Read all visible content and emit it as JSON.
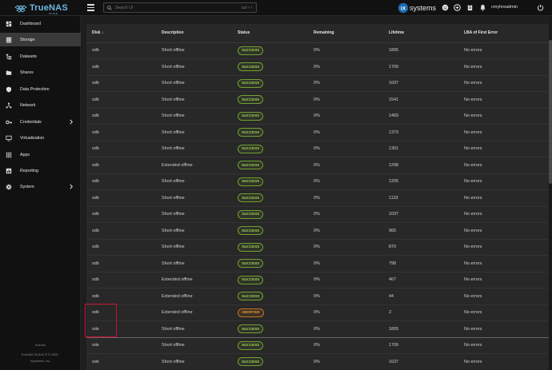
{
  "brand": {
    "name": "TrueNAS",
    "edition": "SCALE",
    "color": "#6fb7e0"
  },
  "search": {
    "placeholder": "Search UI",
    "shortcut": "Ctrl + /"
  },
  "partner": {
    "name": "systems",
    "prefix": "iX"
  },
  "user": {
    "name": "cmyhreadmin"
  },
  "topbar_icons": [
    "face-icon",
    "truecommand-icon",
    "jobs-icon",
    "notifications-icon",
    "user-icon",
    "power-icon"
  ],
  "sidebar": {
    "items": [
      {
        "label": "Dashboard",
        "icon": "dashboard-icon",
        "active": false
      },
      {
        "label": "Storage",
        "icon": "storage-icon",
        "active": true
      },
      {
        "label": "Datasets",
        "icon": "datasets-icon",
        "active": false
      },
      {
        "label": "Shares",
        "icon": "shares-icon",
        "active": false
      },
      {
        "label": "Data Protection",
        "icon": "shield-icon",
        "active": false
      },
      {
        "label": "Network",
        "icon": "network-icon",
        "active": false
      },
      {
        "label": "Credentials",
        "icon": "key-icon",
        "active": false,
        "expandable": true
      },
      {
        "label": "Virtualization",
        "icon": "monitor-icon",
        "active": false
      },
      {
        "label": "Apps",
        "icon": "apps-icon",
        "active": false
      },
      {
        "label": "Reporting",
        "icon": "chart-icon",
        "active": false
      },
      {
        "label": "System",
        "icon": "gear-icon",
        "active": false,
        "expandable": true
      }
    ],
    "footer": {
      "hostname": "truenas",
      "copyright": "TrueNAS SCALE ® © 2025 -",
      "company": "iXsystems, Inc."
    }
  },
  "table": {
    "columns": [
      "Disk",
      "Description",
      "Status",
      "Remaining",
      "Lifetime",
      "LBA of First Error"
    ],
    "sort_indicator": "↓",
    "rows": [
      {
        "disk": "sdb",
        "description": "Short offline",
        "status": "SUCCESS",
        "remaining": "0%",
        "lifetime": "1805",
        "lba": "No errors"
      },
      {
        "disk": "sdb",
        "description": "Short offline",
        "status": "SUCCESS",
        "remaining": "0%",
        "lifetime": "1709",
        "lba": "No errors"
      },
      {
        "disk": "sdb",
        "description": "Short offline",
        "status": "SUCCESS",
        "remaining": "0%",
        "lifetime": "1637",
        "lba": "No errors"
      },
      {
        "disk": "sdb",
        "description": "Short offline",
        "status": "SUCCESS",
        "remaining": "0%",
        "lifetime": "1541",
        "lba": "No errors"
      },
      {
        "disk": "sdb",
        "description": "Short offline",
        "status": "SUCCESS",
        "remaining": "0%",
        "lifetime": "1469",
        "lba": "No errors"
      },
      {
        "disk": "sdb",
        "description": "Short offline",
        "status": "SUCCESS",
        "remaining": "0%",
        "lifetime": "1373",
        "lba": "No errors"
      },
      {
        "disk": "sdb",
        "description": "Short offline",
        "status": "SUCCESS",
        "remaining": "0%",
        "lifetime": "1301",
        "lba": "No errors"
      },
      {
        "disk": "sdb",
        "description": "Extended offline",
        "status": "SUCCESS",
        "remaining": "0%",
        "lifetime": "1298",
        "lba": "No errors"
      },
      {
        "disk": "sdb",
        "description": "Short offline",
        "status": "SUCCESS",
        "remaining": "0%",
        "lifetime": "1205",
        "lba": "No errors"
      },
      {
        "disk": "sdb",
        "description": "Short offline",
        "status": "SUCCESS",
        "remaining": "0%",
        "lifetime": "1133",
        "lba": "No errors"
      },
      {
        "disk": "sdb",
        "description": "Short offline",
        "status": "SUCCESS",
        "remaining": "0%",
        "lifetime": "1037",
        "lba": "No errors"
      },
      {
        "disk": "sdb",
        "description": "Short offline",
        "status": "SUCCESS",
        "remaining": "0%",
        "lifetime": "965",
        "lba": "No errors"
      },
      {
        "disk": "sdb",
        "description": "Short offline",
        "status": "SUCCESS",
        "remaining": "0%",
        "lifetime": "870",
        "lba": "No errors"
      },
      {
        "disk": "sdb",
        "description": "Short offline",
        "status": "SUCCESS",
        "remaining": "0%",
        "lifetime": "798",
        "lba": "No errors"
      },
      {
        "disk": "sdb",
        "description": "Extended offline",
        "status": "SUCCESS",
        "remaining": "0%",
        "lifetime": "467",
        "lba": "No errors"
      },
      {
        "disk": "sdb",
        "description": "Extended offline",
        "status": "SUCCESS",
        "remaining": "0%",
        "lifetime": "44",
        "lba": "No errors"
      },
      {
        "disk": "sdb",
        "description": "Extended offline",
        "status": "ABORTED",
        "remaining": "0%",
        "lifetime": "2",
        "lba": "No errors"
      },
      {
        "disk": "sde",
        "description": "Short offline",
        "status": "SUCCESS",
        "remaining": "0%",
        "lifetime": "1805",
        "lba": "No errors",
        "highlight": true
      },
      {
        "disk": "sde",
        "description": "Short offline",
        "status": "SUCCESS",
        "remaining": "0%",
        "lifetime": "1709",
        "lba": "No errors"
      },
      {
        "disk": "sde",
        "description": "Short offline",
        "status": "SUCCESS",
        "remaining": "0%",
        "lifetime": "1637",
        "lba": "No errors"
      }
    ]
  },
  "colors": {
    "success": "#9fd152",
    "aborted": "#f0962f",
    "annotation": "#c8102e",
    "background": "#1e1e1e",
    "sidebar": "#111111"
  }
}
